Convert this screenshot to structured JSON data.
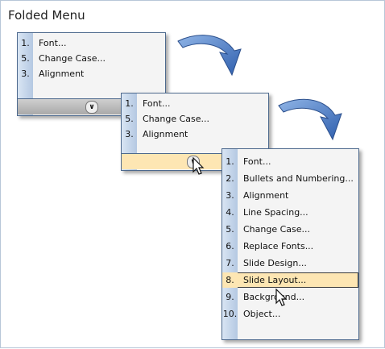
{
  "title": "Folded Menu",
  "menus": [
    {
      "items": [
        {
          "num": "1.",
          "label": "Font..."
        },
        {
          "num": "5.",
          "label": "Change Case..."
        },
        {
          "num": "3.",
          "label": "Alignment"
        }
      ],
      "expander_state": "collapsed"
    },
    {
      "items": [
        {
          "num": "1.",
          "label": "Font..."
        },
        {
          "num": "5.",
          "label": "Change Case..."
        },
        {
          "num": "3.",
          "label": "Alignment"
        }
      ],
      "expander_state": "hover"
    },
    {
      "items": [
        {
          "num": "1.",
          "label": "Font..."
        },
        {
          "num": "2.",
          "label": "Bullets and Numbering..."
        },
        {
          "num": "3.",
          "label": "Alignment"
        },
        {
          "num": "4.",
          "label": "Line Spacing..."
        },
        {
          "num": "5.",
          "label": "Change Case..."
        },
        {
          "num": "6.",
          "label": "Replace Fonts..."
        },
        {
          "num": "7.",
          "label": "Slide Design..."
        },
        {
          "num": "8.",
          "label": "Slide Layout..."
        },
        {
          "num": "9.",
          "label": "Background..."
        },
        {
          "num": "10.",
          "label": "Object..."
        }
      ],
      "highlighted": "Slide Layout..."
    }
  ],
  "icons": {
    "expand": "double-chevron-down-icon",
    "cursor": "arrow-cursor-icon",
    "flow_arrow": "curved-arrow-icon"
  },
  "colors": {
    "menu_border": "#4e6a8e",
    "number_bar": "#c5d6ec",
    "highlight": "#fde6b3",
    "arrow_blue": "#3b6fbf"
  }
}
